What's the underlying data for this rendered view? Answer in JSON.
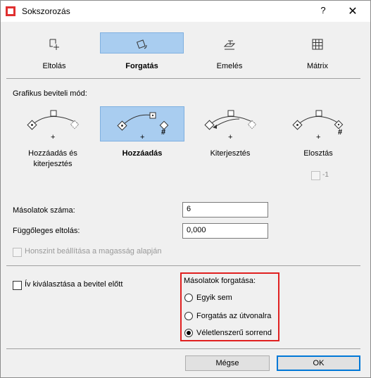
{
  "window": {
    "title": "Sokszorozás",
    "help_label": "?",
    "close_label": "✕"
  },
  "tabs": [
    {
      "label": "Eltolás",
      "icon": "move-icon",
      "active": false
    },
    {
      "label": "Forgatás",
      "icon": "rotate-icon",
      "active": true
    },
    {
      "label": "Emelés",
      "icon": "elevate-icon",
      "active": false
    },
    {
      "label": "Mátrix",
      "icon": "matrix-icon",
      "active": false
    }
  ],
  "input_mode": {
    "label": "Grafikus beviteli mód:",
    "modes": [
      {
        "label": "Hozzáadás és kiterjesztés",
        "selected": false
      },
      {
        "label": "Hozzáadás",
        "selected": true
      },
      {
        "label": "Kiterjesztés",
        "selected": false
      },
      {
        "label": "Elosztás",
        "selected": false
      }
    ],
    "minus_one_label": "-1",
    "symbol_plus": "+",
    "symbol_hash": "#"
  },
  "fields": {
    "copies_label": "Másolatok száma:",
    "copies_value": "6",
    "vertical_offset_label": "Függőleges eltolás:",
    "vertical_offset_value": "0,000",
    "story_label": "Honszint beállítása a magasság alapján"
  },
  "arc_checkbox": {
    "label": "Ív kiválasztása a bevitel előtt",
    "checked": false
  },
  "rotation": {
    "title": "Másolatok forgatása:",
    "options": [
      {
        "label": "Egyik sem",
        "selected": false
      },
      {
        "label": "Forgatás az útvonalra",
        "selected": false
      },
      {
        "label": "Véletlenszerű sorrend",
        "selected": true
      }
    ]
  },
  "buttons": {
    "cancel": "Mégse",
    "ok": "OK"
  },
  "colors": {
    "selection": "#a9cdf0",
    "highlight_border": "#e02020",
    "primary_border": "#0078d7"
  }
}
